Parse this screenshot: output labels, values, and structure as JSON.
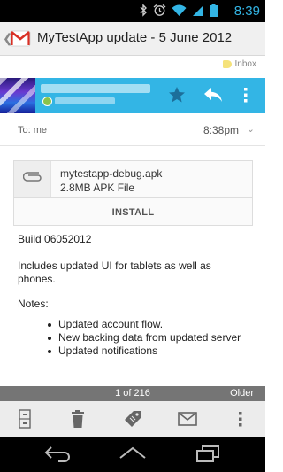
{
  "status_bar": {
    "time": "8:39",
    "icons": [
      "bluetooth-icon",
      "alarm-icon",
      "wifi-icon",
      "signal-icon",
      "battery-icon"
    ],
    "time_color": "#33b5e5"
  },
  "action_bar": {
    "title": "MyTestApp update - 5 June 2012",
    "back_icon": "chevron-left-icon",
    "app_icon": "gmail-icon"
  },
  "labels": {
    "inbox": "Inbox",
    "tag_color": "#f5e27a"
  },
  "sender_bar": {
    "accent_color": "#33b5e5",
    "icons": [
      "star-icon",
      "reply-icon",
      "overflow-menu-icon"
    ]
  },
  "recipients": {
    "to_label": "To:",
    "to_value": "me",
    "time": "8:38pm"
  },
  "attachment": {
    "filename": "mytestapp-debug.apk",
    "size": "2.8MB APK File",
    "install_label": "INSTALL",
    "icon": "paperclip-icon"
  },
  "body": {
    "build": "Build 06052012",
    "includes": "Includes updated UI for tablets as well as phones.",
    "notes_label": "Notes:",
    "notes": [
      "Updated account flow.",
      "New backing data from updated server",
      "Updated notifications"
    ]
  },
  "pager": {
    "count": "1 of 216",
    "older_label": "Older"
  },
  "toolbar": {
    "icons": [
      "archive-icon",
      "delete-icon",
      "label-icon",
      "mark-unread-icon",
      "overflow-menu-icon"
    ]
  },
  "nav_bar": {
    "icons": [
      "back-nav-icon",
      "home-nav-icon",
      "recents-nav-icon"
    ]
  }
}
